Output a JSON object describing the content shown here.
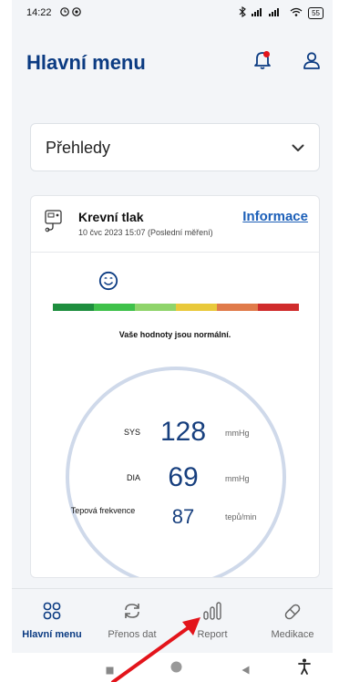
{
  "status_bar": {
    "time": "14:22",
    "battery": "55"
  },
  "header": {
    "title": "Hlavní menu"
  },
  "dropdown": {
    "selected": "Přehledy"
  },
  "card": {
    "title": "Krevní tlak",
    "subtitle": "10 čvc 2023 15:07 (Poslední měření)",
    "link": "Informace",
    "status_text": "Vaše hodnoty jsou normální.",
    "scale_colors": [
      "#1e8e3e",
      "#3fc14b",
      "#8fd46b",
      "#e9c93b",
      "#e07b4a",
      "#d02c2c"
    ],
    "readings": [
      {
        "label": "SYS",
        "value": "128",
        "unit": "mmHg"
      },
      {
        "label": "DIA",
        "value": "69",
        "unit": "mmHg"
      },
      {
        "label": "Tepová frekvence",
        "value": "87",
        "unit": "tepů/min"
      }
    ]
  },
  "nav": {
    "items": [
      {
        "label": "Hlavní menu",
        "icon": "grid-icon",
        "active": true
      },
      {
        "label": "Přenos dat",
        "icon": "sync-icon",
        "active": false
      },
      {
        "label": "Report",
        "icon": "bars-icon",
        "active": false
      },
      {
        "label": "Medikace",
        "icon": "pill-icon",
        "active": false
      }
    ]
  },
  "colors": {
    "brand": "#0b3b82",
    "link": "#1c5fb8",
    "annotation_arrow": "#e3141b"
  }
}
